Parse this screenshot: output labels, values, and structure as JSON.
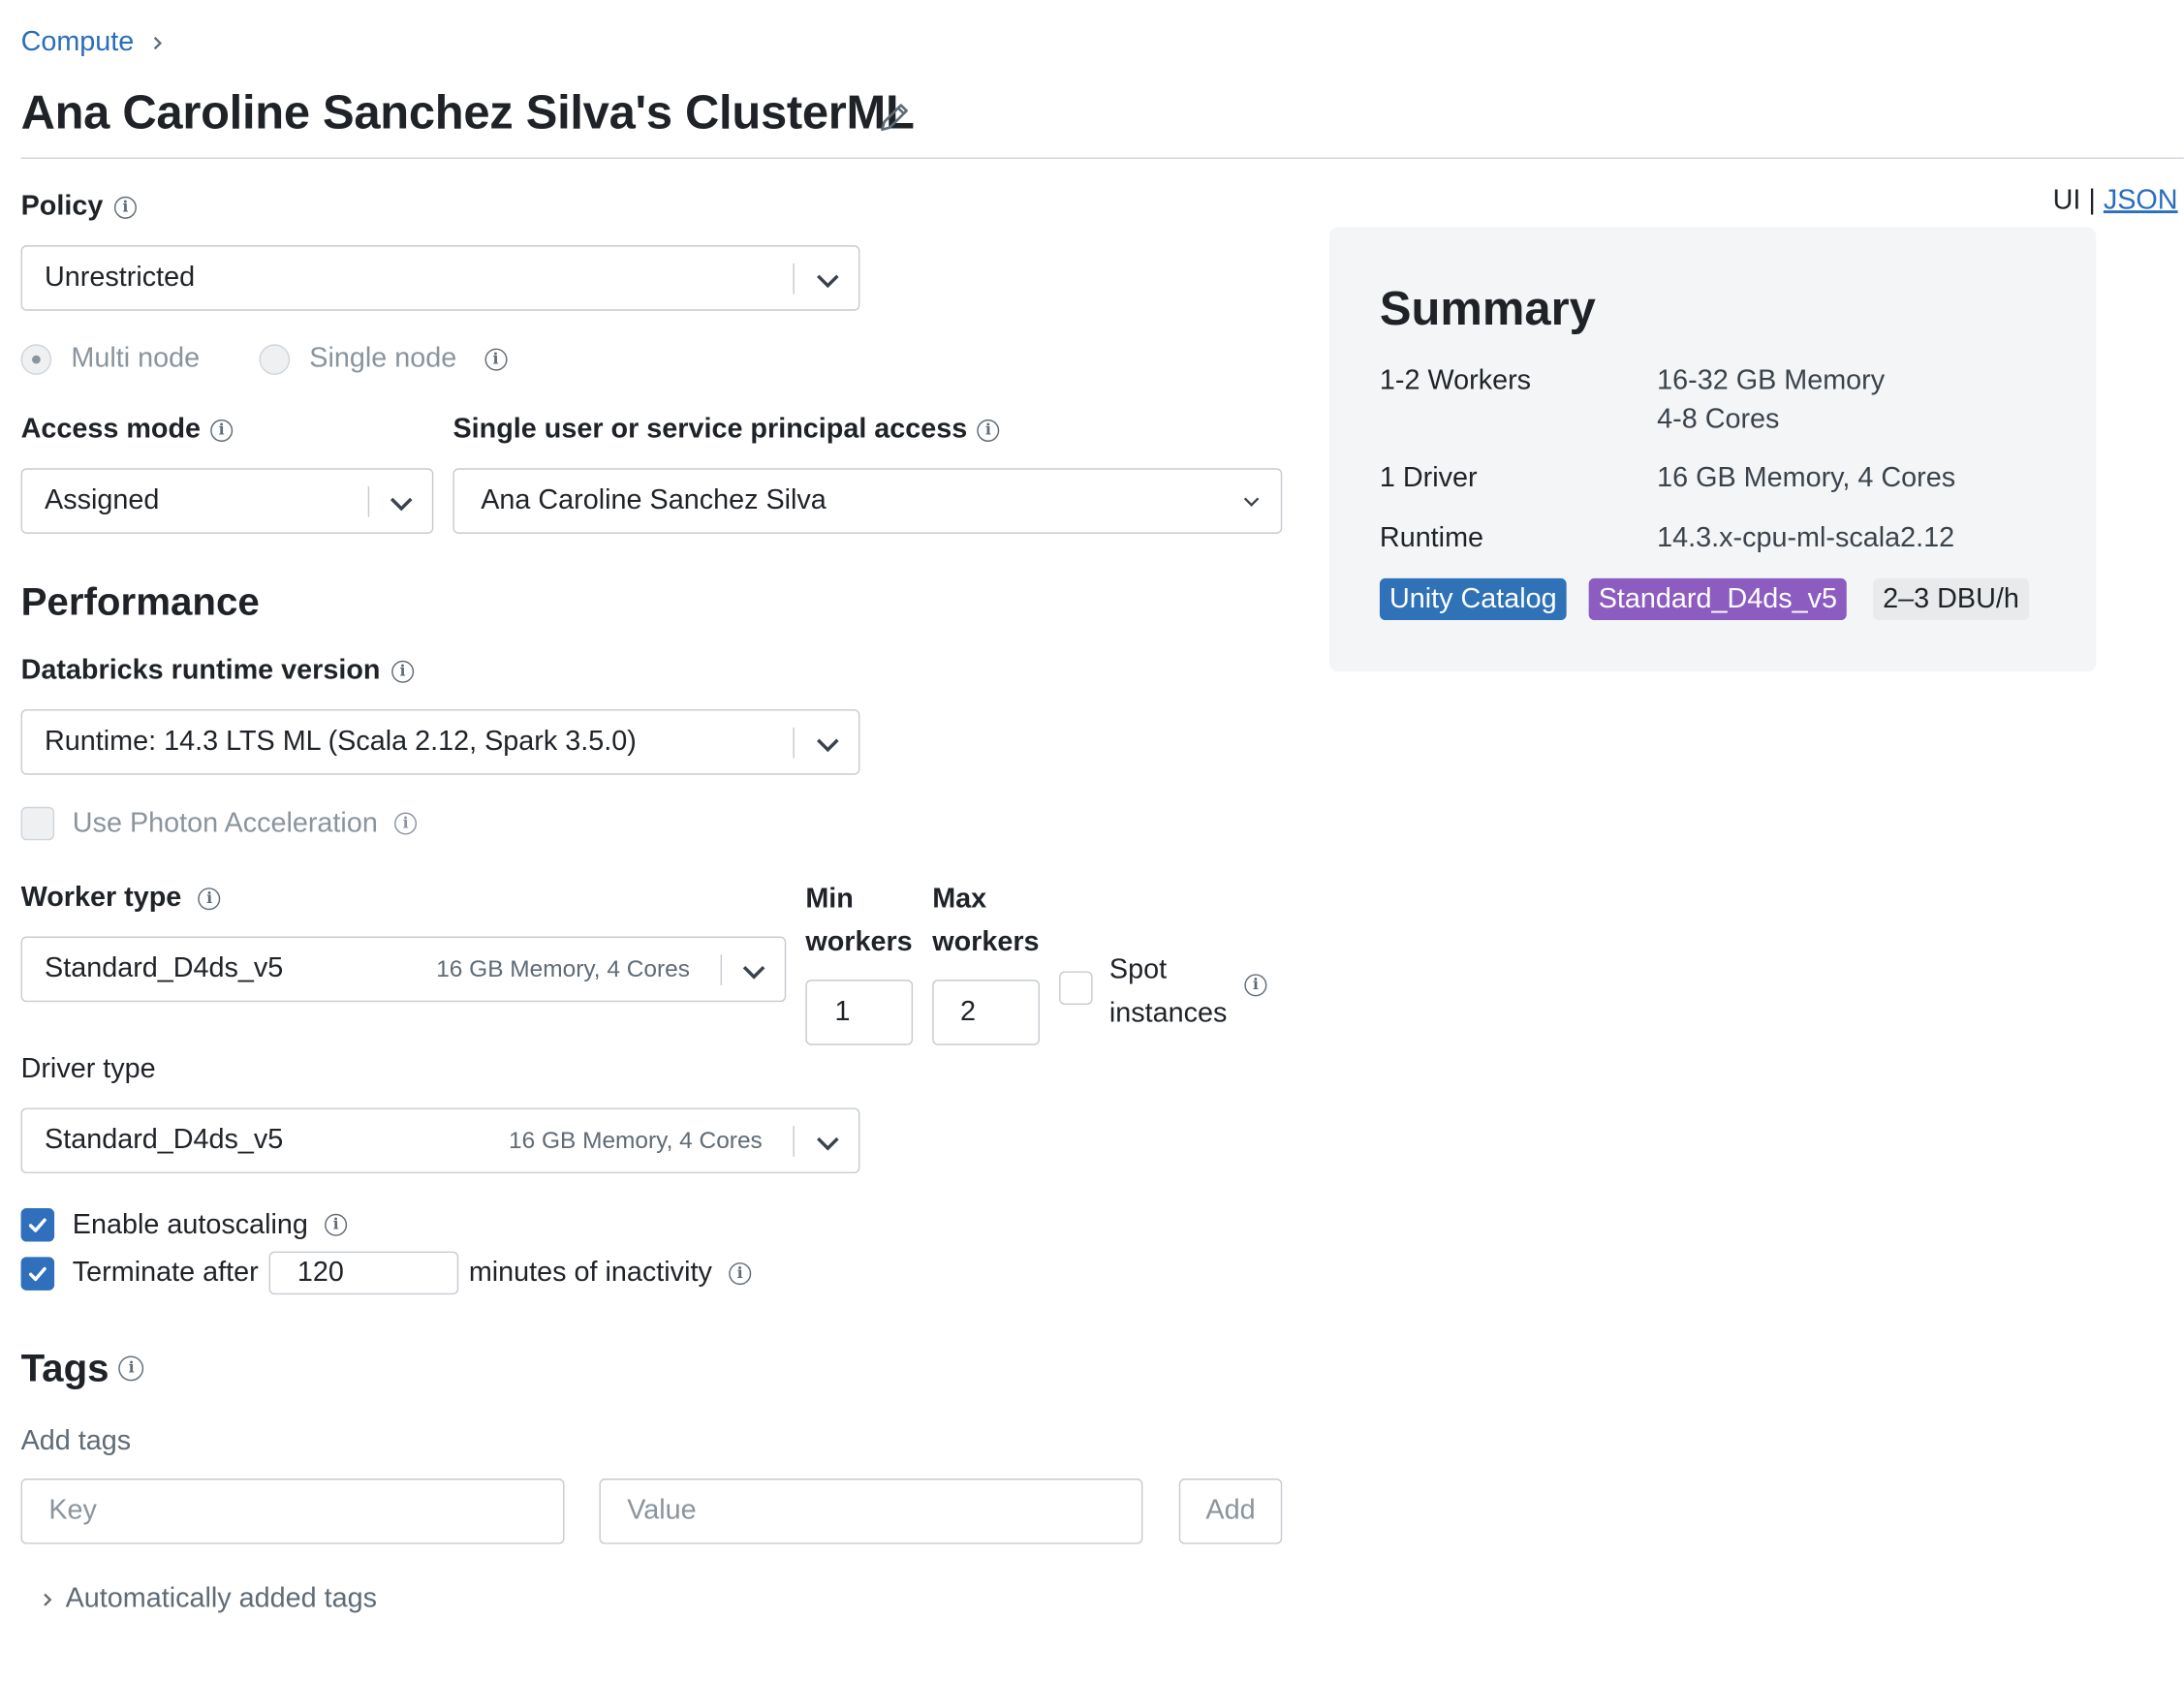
{
  "breadcrumb": {
    "root": "Compute"
  },
  "page": {
    "title": "Ana Caroline Sanchez Silva's ClusterML"
  },
  "view_toggle": {
    "ui": "UI",
    "separator": "|",
    "json": "JSON"
  },
  "policy": {
    "label": "Policy",
    "value": "Unrestricted"
  },
  "node_mode": {
    "multi": "Multi node",
    "single": "Single node",
    "selected": "Multi node"
  },
  "access_mode": {
    "label": "Access mode",
    "value": "Assigned"
  },
  "single_user": {
    "label": "Single user or service principal access",
    "value": "Ana Caroline Sanchez Silva"
  },
  "performance": {
    "heading": "Performance",
    "runtime_label": "Databricks runtime version",
    "runtime_value": "Runtime: 14.3 LTS ML (Scala 2.12, Spark 3.5.0)",
    "photon_label": "Use Photon Acceleration",
    "worker_type_label": "Worker type",
    "worker_type_value": "Standard_D4ds_v5",
    "worker_type_spec": "16 GB Memory, 4 Cores",
    "min_workers_label_1": "Min",
    "min_workers_label_2": "workers",
    "min_workers": "1",
    "max_workers_label_1": "Max",
    "max_workers_label_2": "workers",
    "max_workers": "2",
    "spot_label_1": "Spot",
    "spot_label_2": "instances",
    "driver_type_label": "Driver type",
    "driver_type_value": "Standard_D4ds_v5",
    "driver_type_spec": "16 GB Memory, 4 Cores",
    "autoscaling_label": "Enable autoscaling",
    "autoscaling_checked": true,
    "terminate_label": "Terminate after",
    "terminate_checked": true,
    "terminate_minutes": "120",
    "terminate_suffix": "minutes of inactivity"
  },
  "tags": {
    "heading": "Tags",
    "add_label": "Add tags",
    "key_placeholder": "Key",
    "value_placeholder": "Value",
    "add_button": "Add",
    "auto_tags": "Automatically added tags"
  },
  "summary": {
    "title": "Summary",
    "workers_label": "1-2 Workers",
    "workers_memory": "16-32 GB Memory",
    "workers_cores": "4-8 Cores",
    "driver_label": "1 Driver",
    "driver_value": "16 GB Memory, 4 Cores",
    "runtime_label": "Runtime",
    "runtime_value": "14.3.x-cpu-ml-scala2.12",
    "badges": [
      "Unity Catalog",
      "Standard_D4ds_v5",
      "2–3 DBU/h"
    ]
  },
  "colors": {
    "link": "#2a6ebb",
    "checkbox": "#2f6fbc",
    "badge_unity": "#2f72b7",
    "badge_instance": "#8c5cc0",
    "summary_bg": "#f4f5f6"
  }
}
